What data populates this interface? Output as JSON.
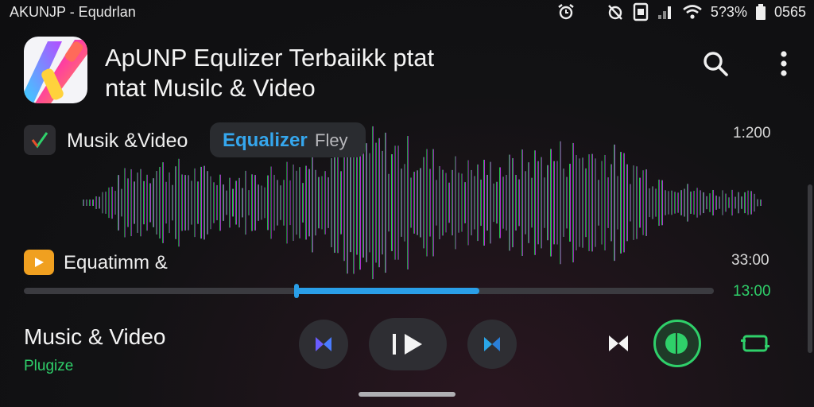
{
  "status_bar": {
    "title": "AKUNJP - Equdrlan",
    "percent": "5?3%",
    "clock": "0565",
    "icons": [
      "alarm-icon",
      "alarm-off-icon",
      "sim-icon",
      "signal-icon",
      "wifi-icon",
      "battery-icon"
    ]
  },
  "header": {
    "title_line1": "ApUNP Equlizer Terbaiikk  ptat",
    "title_line2": "ntat Musilc & Video",
    "icons": [
      "search-icon",
      "more-vertical-icon"
    ]
  },
  "chips": {
    "musik_label": "Musik  &Video",
    "eq_label_a": "Equalizer",
    "eq_label_b": "Fley"
  },
  "track": {
    "label": "Equatimm  &"
  },
  "times": {
    "top": "1:200",
    "middle": "33:00",
    "green": "13:00"
  },
  "progress": {
    "fraction": 0.66,
    "thumb_fraction": 0.395
  },
  "now_playing": {
    "title": "Music & Video",
    "subtitle": "Plugize"
  },
  "controls": [
    "previous-icon",
    "play-icon",
    "next-icon",
    "shuffle-icon",
    "equalizer-toggle-icon",
    "repeat-icon"
  ],
  "colors": {
    "accent_blue": "#2a9fe8",
    "accent_green": "#2fd06a",
    "wave_green": "#27d44a",
    "wave_blue": "#2a9fe8",
    "wave_purple": "#9b30e8",
    "wave_pink": "#e8208a"
  }
}
